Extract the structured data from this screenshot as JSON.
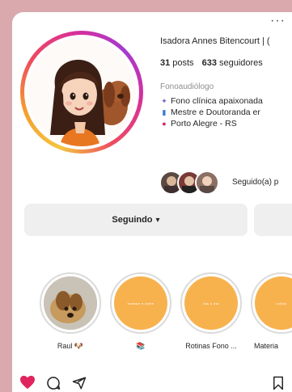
{
  "header": {
    "more_icon": "more-dots-icon",
    "more_glyph": "···"
  },
  "profile": {
    "name": "Isadora Annes Bitencourt | (",
    "posts_count": "31",
    "posts_label": "posts",
    "followers_count": "633",
    "followers_label": "seguidores",
    "category": "Fonoaudiólogo",
    "bio": [
      {
        "icon": "sparkle-icon",
        "glyph": "✨",
        "text": "Fono clínica apaixonada"
      },
      {
        "icon": "books-icon",
        "glyph": "📚",
        "text": "Mestre e Doutoranda er"
      },
      {
        "icon": "pin-icon",
        "glyph": "📍",
        "text": "Porto Alegre - RS"
      }
    ],
    "followed_by": "Seguido(a) p"
  },
  "buttons": {
    "following_label": "Seguindo",
    "following_chevron": "▾"
  },
  "highlights": [
    {
      "label": "Raul 🐶",
      "circle_text": ""
    },
    {
      "label": "📚",
      "circle_text": "mamae e bebe"
    },
    {
      "label": "Rotinas Fono ...",
      "circle_text": "dia a dia"
    },
    {
      "label": "Materia",
      "circle_text": "rotina"
    }
  ],
  "colors": {
    "accent_heart": "#e0245e",
    "highlight_fill": "#f7b24e",
    "button_bg": "#efefef"
  }
}
